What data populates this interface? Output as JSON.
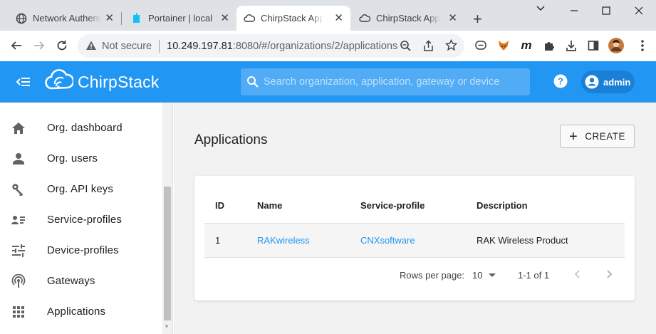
{
  "browser": {
    "tabs": [
      {
        "title": "Network Authentication",
        "icon": "globe-icon",
        "active": false
      },
      {
        "title": "Portainer | local",
        "icon": "portainer-icon",
        "active": false
      },
      {
        "title": "ChirpStack Application",
        "icon": "cloud-icon",
        "active": true
      },
      {
        "title": "ChirpStack Application",
        "icon": "cloud-icon",
        "active": false
      }
    ],
    "new_tab": "+",
    "close_glyph": "✕",
    "security_label": "Not secure",
    "url_host": "10.249.197.81",
    "url_rest": ":8080/#/organizations/2/applications"
  },
  "header": {
    "brand": "ChirpStack",
    "search_placeholder": "Search organization, application, gateway or device",
    "user": "admin",
    "colors": {
      "appbar": "#2196f3",
      "link": "#2196f3"
    }
  },
  "sidebar": {
    "items": [
      {
        "label": "Org. dashboard",
        "icon": "home-icon"
      },
      {
        "label": "Org. users",
        "icon": "person-icon"
      },
      {
        "label": "Org. API keys",
        "icon": "key-icon"
      },
      {
        "label": "Service-profiles",
        "icon": "profiles-icon"
      },
      {
        "label": "Device-profiles",
        "icon": "tune-icon"
      },
      {
        "label": "Gateways",
        "icon": "gateway-icon"
      },
      {
        "label": "Applications",
        "icon": "apps-icon"
      }
    ]
  },
  "main": {
    "title": "Applications",
    "create_label": "CREATE",
    "table": {
      "columns": [
        "ID",
        "Name",
        "Service-profile",
        "Description"
      ],
      "rows": [
        {
          "id": "1",
          "name": "RAKwireless",
          "service_profile": "CNXsoftware",
          "description": "RAK Wireless Product"
        }
      ]
    },
    "pagination": {
      "rows_per_page_label": "Rows per page:",
      "rows_per_page": "10",
      "range": "1-1 of 1"
    }
  }
}
